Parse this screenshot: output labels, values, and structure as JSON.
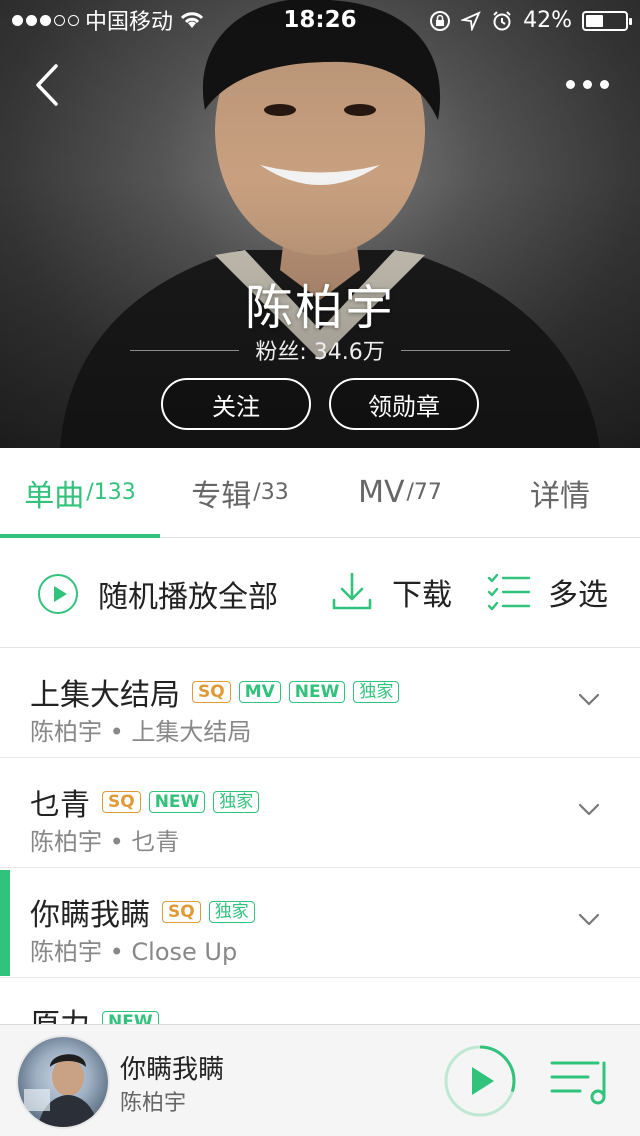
{
  "status_bar": {
    "carrier": "中国移动",
    "time": "18:26",
    "battery": "42%",
    "battery_level": 0.42,
    "icons": [
      "wifi-icon",
      "lock-rotation-icon",
      "location-icon",
      "alarm-icon",
      "battery-icon"
    ]
  },
  "hero": {
    "artist": "陈柏宇",
    "fans": "粉丝: 34.6万",
    "follow_label": "关注",
    "badge_label": "领勋章"
  },
  "tabs": [
    {
      "label": "单曲",
      "count": "/133",
      "active": true
    },
    {
      "label": "专辑",
      "count": "/33",
      "active": false
    },
    {
      "label": "MV",
      "count": "/77",
      "active": false
    },
    {
      "label": "详情",
      "count": "",
      "active": false
    }
  ],
  "actions": {
    "shuffle_label": "随机播放全部",
    "download_label": "下载",
    "multiselect_label": "多选"
  },
  "songs": [
    {
      "title": "上集大结局",
      "subtitle": "陈柏宇 • 上集大结局",
      "badges": [
        "SQ",
        "MV",
        "NEW",
        "独家"
      ]
    },
    {
      "title": "乜青",
      "subtitle": "陈柏宇 • 乜青",
      "badges": [
        "SQ",
        "NEW",
        "独家"
      ]
    },
    {
      "title": "你瞒我瞒",
      "subtitle": "陈柏宇 • Close Up",
      "badges": [
        "SQ",
        "独家"
      ],
      "playing": true
    },
    {
      "title": "原力",
      "subtitle": "",
      "badges": [
        "NEW"
      ]
    }
  ],
  "player": {
    "title": "你瞒我瞒",
    "artist": "陈柏宇",
    "progress": 0.3
  },
  "colors": {
    "accent": "#31c27c",
    "sq": "#e09a35"
  }
}
